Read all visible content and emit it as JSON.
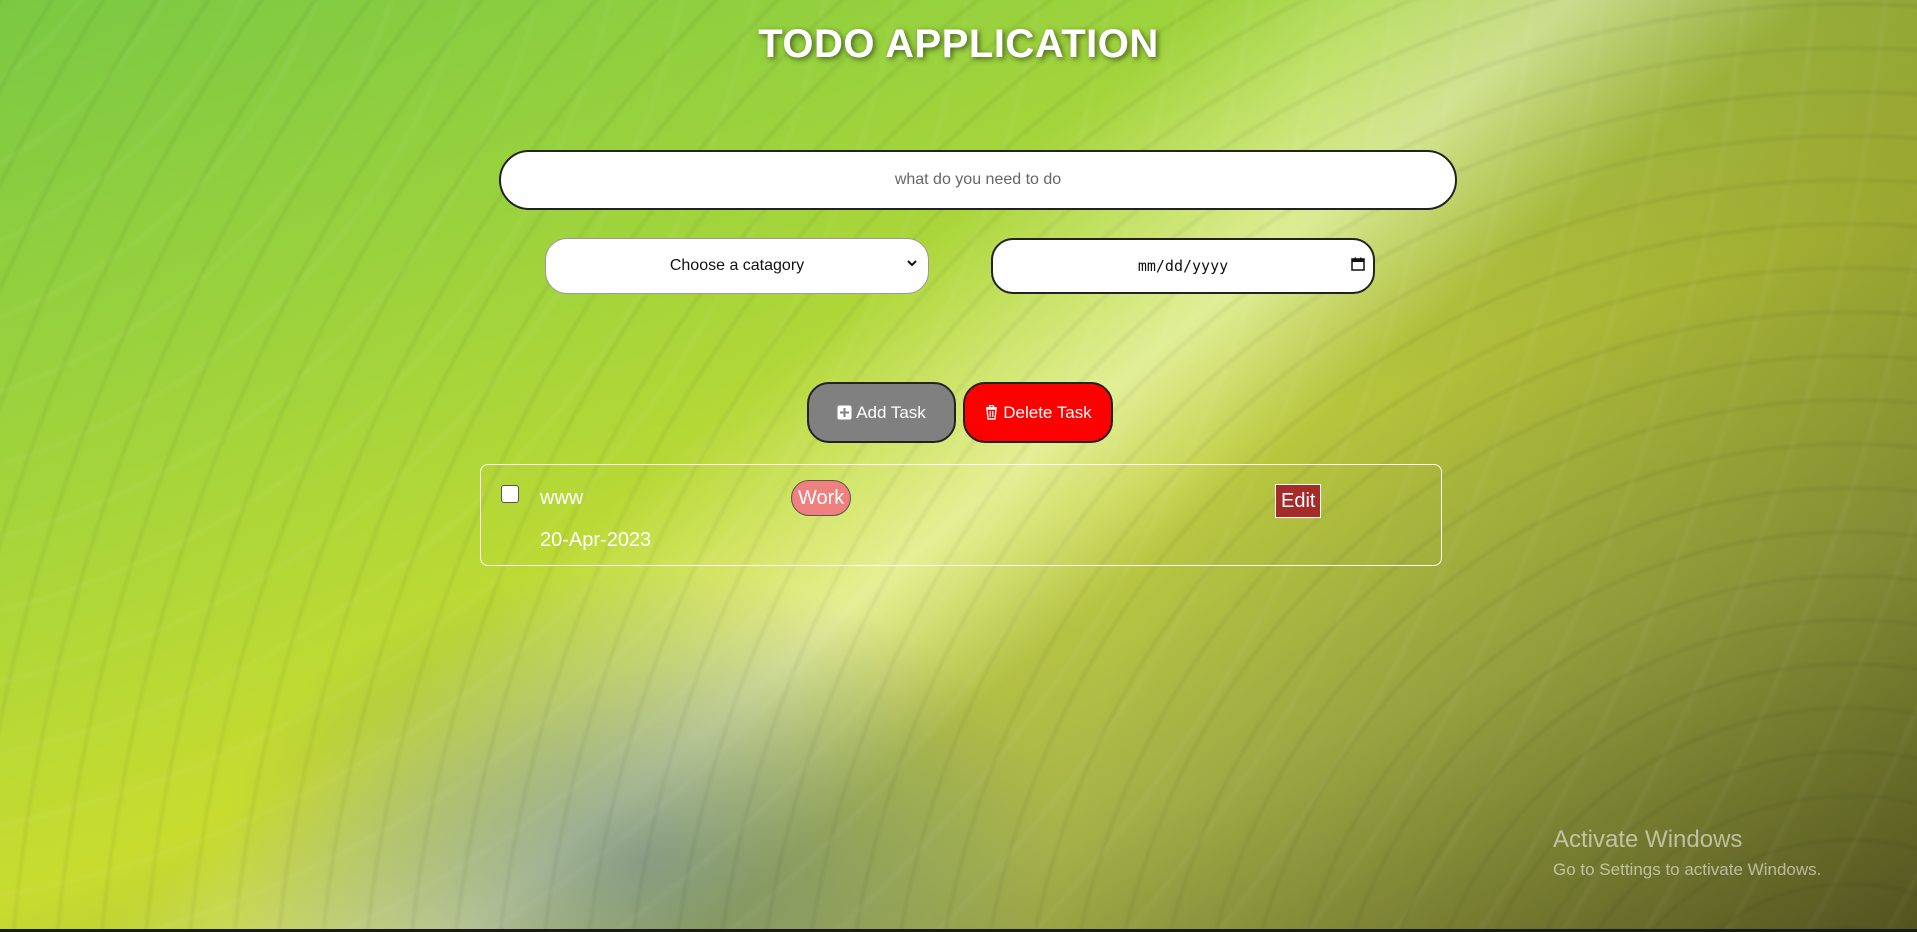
{
  "app": {
    "title": "TODO APPLICATION"
  },
  "form": {
    "task_placeholder": "what do you need to do",
    "category_selected": "Choose a catagory",
    "date_value": "mm/dd/yyyy"
  },
  "actions": {
    "add_label": "Add Task",
    "delete_label": "Delete Task"
  },
  "tasks": [
    {
      "name": "www",
      "category": "Work",
      "date": "20-Apr-2023",
      "checked": false,
      "edit_label": "Edit"
    }
  ],
  "watermark": {
    "line1": "Activate Windows",
    "line2": "Go to Settings to activate Windows."
  },
  "colors": {
    "add_button": "#808080",
    "delete_button": "#ff0000",
    "category_tag": "#f08080",
    "edit_button": "#a52a2a"
  },
  "icons": [
    "plus-square-icon",
    "trash-icon",
    "chevron-down-icon",
    "calendar-icon"
  ]
}
